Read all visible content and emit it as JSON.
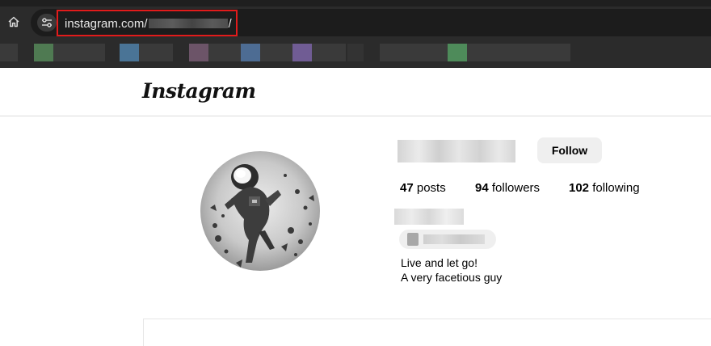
{
  "browser": {
    "url_prefix": "instagram.com/",
    "url_suffix": "/",
    "home_icon": "home-icon",
    "site_info_icon": "tune-icon",
    "highlight_color": "#e21b1b"
  },
  "bookmarks_bar": {
    "chip_colors": [
      "#3a3a3a",
      "#4f7a52",
      "#3a3a3a",
      "#4a7496",
      "#3a3a3a",
      "#6c5468",
      "#3a3a3a",
      "#4d6c93",
      "#3a3a3a",
      "#705c94",
      "#3a3a3a",
      "#333333",
      "#3a3a3a",
      "#3a3a3a",
      "#4e8b5a",
      "#3a3a3a",
      "#3a3a3a"
    ]
  },
  "header": {
    "logo": "Instagram"
  },
  "profile": {
    "follow_label": "Follow",
    "stats": {
      "posts_count": "47",
      "posts_label": " posts",
      "followers_count": "94",
      "followers_label": " followers",
      "following_count": "102",
      "following_label": " following"
    },
    "bio_lines": [
      "Live and let go!",
      "A very facetious guy"
    ]
  }
}
